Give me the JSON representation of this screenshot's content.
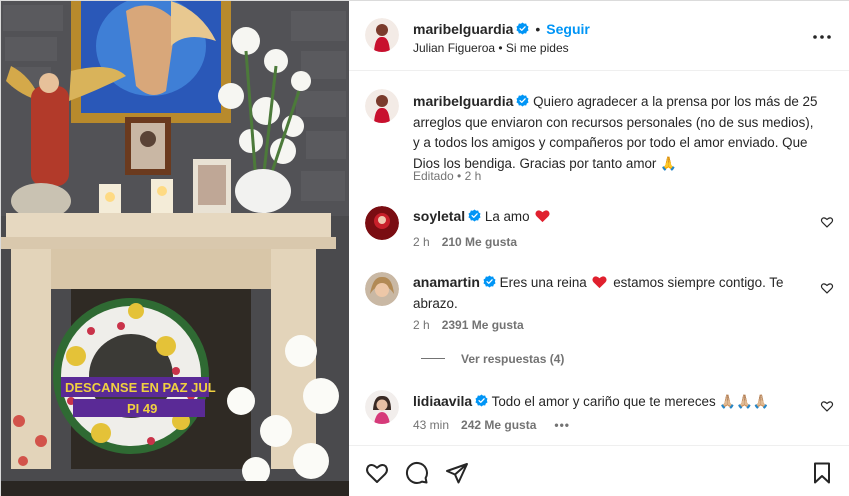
{
  "post": {
    "author": "maribelguardia",
    "follow_label": "Seguir",
    "separator": "•",
    "audio": "Julian Figueroa • Si me pides"
  },
  "caption": {
    "author": "maribelguardia",
    "text": "Quiero agradecer a la prensa por los más de 25 arreglos que enviaron con recursos personales (no de sus medios), y a todos los amigos y compañeros por todo el amor enviado. Que Dios los bendiga. Gracias por tanto amor 🙏",
    "meta": "Editado • 2 h"
  },
  "comments": [
    {
      "user": "soyletal",
      "text_before": "La amo",
      "text_after": "",
      "time": "2 h",
      "likes": "210 Me gusta",
      "has_heart_emoji": true
    },
    {
      "user": "anamartin",
      "text_before": "Eres una reina",
      "text_after": "estamos siempre contigo. Te abrazo.",
      "time": "2 h",
      "likes": "2391 Me gusta",
      "has_heart_emoji": true
    },
    {
      "user": "lidiaavila",
      "text_before": "Todo el amor y cariño que te mereces 🙏🏼🙏🏼🙏🏼",
      "text_after": "",
      "time": "43 min",
      "likes": "242 Me gusta",
      "has_heart_emoji": false
    }
  ],
  "replies_label": "Ver respuestas (4)",
  "comment_more": "•••",
  "wreath_ribbon": [
    "DESCANSE EN PAZ JUL",
    "PI 49"
  ],
  "colors": {
    "accent": "#0095f6",
    "verified": "#0095f6",
    "heart": "#e0245e",
    "muted": "#737373"
  },
  "icons": [
    "more-options-icon",
    "verified-badge-icon",
    "heart-icon",
    "comment-icon",
    "share-icon",
    "bookmark-icon"
  ]
}
